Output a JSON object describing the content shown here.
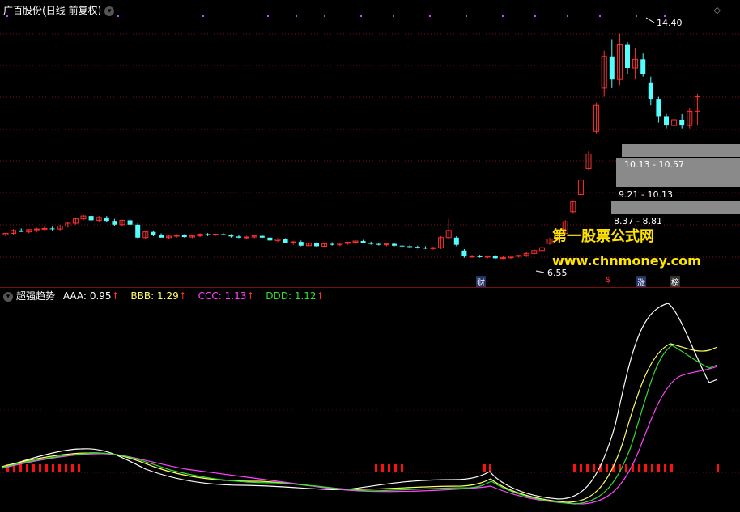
{
  "price_header": {
    "stock_name": "广百股份",
    "period": "(日线 前复权)",
    "dropdown_glyph": "▾"
  },
  "indicator_header": {
    "name": "超强趋势",
    "items": [
      {
        "label": "AAA:",
        "value": "0.95",
        "arrow": "↑",
        "color": "#ffffff"
      },
      {
        "label": "BBB:",
        "value": "1.29",
        "arrow": "↑",
        "color": "#ffff66"
      },
      {
        "label": "CCC:",
        "value": "1.13",
        "arrow": "↑",
        "color": "#ff44ff"
      },
      {
        "label": "DDD:",
        "value": "1.12",
        "arrow": "↑",
        "color": "#33dd33"
      }
    ]
  },
  "annotations": {
    "high": "14.40",
    "low": "6.55",
    "zone1": "10.13 - 10.57",
    "zone2": "9.21 - 10.13",
    "zone3": "8.37 - 8.81"
  },
  "event_tags": [
    {
      "text": "财",
      "color": "#3a6cff"
    },
    {
      "text": "$",
      "color": "#ff3333"
    },
    {
      "text": "涨",
      "color": "#3a9cff"
    },
    {
      "text": "榜",
      "color": "#ffcc00"
    }
  ],
  "watermark": {
    "line1": "第一股票公式网",
    "line2": "www.chnmoney.com"
  },
  "colors": {
    "up": "#ff3030",
    "down": "#54ffff",
    "grid": "#7a1010"
  },
  "chart_data": {
    "type": "candlestick",
    "ylim": [
      6,
      15
    ],
    "candles": [
      [
        7.4,
        7.45,
        7.35,
        7.45
      ],
      [
        7.45,
        7.6,
        7.4,
        7.55
      ],
      [
        7.55,
        7.62,
        7.5,
        7.5
      ],
      [
        7.5,
        7.6,
        7.45,
        7.58
      ],
      [
        7.58,
        7.64,
        7.5,
        7.6
      ],
      [
        7.6,
        7.7,
        7.55,
        7.62
      ],
      [
        7.62,
        7.68,
        7.55,
        7.6
      ],
      [
        7.6,
        7.75,
        7.55,
        7.7
      ],
      [
        7.7,
        7.85,
        7.65,
        7.8
      ],
      [
        7.8,
        8.0,
        7.75,
        7.95
      ],
      [
        7.95,
        8.1,
        7.9,
        8.05
      ],
      [
        8.05,
        8.1,
        7.85,
        7.9
      ],
      [
        7.9,
        8.05,
        7.85,
        8.0
      ],
      [
        8.0,
        8.05,
        7.85,
        7.88
      ],
      [
        7.88,
        7.95,
        7.7,
        7.75
      ],
      [
        7.75,
        7.92,
        7.7,
        7.9
      ],
      [
        7.9,
        7.95,
        7.7,
        7.75
      ],
      [
        7.75,
        7.8,
        7.25,
        7.3
      ],
      [
        7.3,
        7.55,
        7.25,
        7.5
      ],
      [
        7.5,
        7.55,
        7.35,
        7.4
      ],
      [
        7.4,
        7.45,
        7.3,
        7.3
      ],
      [
        7.3,
        7.4,
        7.25,
        7.35
      ],
      [
        7.35,
        7.42,
        7.3,
        7.38
      ],
      [
        7.38,
        7.42,
        7.3,
        7.32
      ],
      [
        7.32,
        7.4,
        7.28,
        7.36
      ],
      [
        7.36,
        7.45,
        7.32,
        7.42
      ],
      [
        7.42,
        7.46,
        7.35,
        7.4
      ],
      [
        7.4,
        7.44,
        7.36,
        7.42
      ],
      [
        7.42,
        7.46,
        7.38,
        7.4
      ],
      [
        7.4,
        7.42,
        7.3,
        7.34
      ],
      [
        7.34,
        7.38,
        7.28,
        7.3
      ],
      [
        7.3,
        7.36,
        7.25,
        7.32
      ],
      [
        7.32,
        7.4,
        7.28,
        7.36
      ],
      [
        7.36,
        7.38,
        7.28,
        7.3
      ],
      [
        7.3,
        7.32,
        7.18,
        7.2
      ],
      [
        7.2,
        7.28,
        7.15,
        7.25
      ],
      [
        7.25,
        7.28,
        7.1,
        7.12
      ],
      [
        7.12,
        7.18,
        7.05,
        7.15
      ],
      [
        7.15,
        7.2,
        7.0,
        7.02
      ],
      [
        7.02,
        7.12,
        7.0,
        7.1
      ],
      [
        7.1,
        7.14,
        6.98,
        7.0
      ],
      [
        7.0,
        7.1,
        6.98,
        7.08
      ],
      [
        7.08,
        7.14,
        7.02,
        7.05
      ],
      [
        7.05,
        7.12,
        7.0,
        7.1
      ],
      [
        7.1,
        7.16,
        7.05,
        7.14
      ],
      [
        7.14,
        7.2,
        7.08,
        7.18
      ],
      [
        7.18,
        7.22,
        7.1,
        7.12
      ],
      [
        7.12,
        7.16,
        7.05,
        7.08
      ],
      [
        7.08,
        7.12,
        7.02,
        7.05
      ],
      [
        7.05,
        7.1,
        7.0,
        7.08
      ],
      [
        7.08,
        7.1,
        7.0,
        7.02
      ],
      [
        7.02,
        7.06,
        6.96,
        7.0
      ],
      [
        7.0,
        7.04,
        6.94,
        6.98
      ],
      [
        6.98,
        7.02,
        6.92,
        6.95
      ],
      [
        6.95,
        7.0,
        6.9,
        6.92
      ],
      [
        6.92,
        6.98,
        6.88,
        6.95
      ],
      [
        6.95,
        7.35,
        6.9,
        7.3
      ],
      [
        7.3,
        7.95,
        7.25,
        7.55
      ],
      [
        7.3,
        7.35,
        7.0,
        7.05
      ],
      [
        6.85,
        6.9,
        6.6,
        6.65
      ],
      [
        6.65,
        6.7,
        6.6,
        6.65
      ],
      [
        6.65,
        6.7,
        6.6,
        6.62
      ],
      [
        6.62,
        6.68,
        6.58,
        6.65
      ],
      [
        6.65,
        6.7,
        6.55,
        6.58
      ],
      [
        6.58,
        6.65,
        6.55,
        6.6
      ],
      [
        6.6,
        6.68,
        6.56,
        6.65
      ],
      [
        6.65,
        6.7,
        6.6,
        6.68
      ],
      [
        6.68,
        6.8,
        6.62,
        6.75
      ],
      [
        6.75,
        6.9,
        6.7,
        6.85
      ],
      [
        6.85,
        7.0,
        6.8,
        6.95
      ],
      [
        7.1,
        7.3,
        7.05,
        7.25
      ],
      [
        7.25,
        7.5,
        7.2,
        7.45
      ],
      [
        7.45,
        7.9,
        7.4,
        7.85
      ],
      [
        8.2,
        8.6,
        8.15,
        8.55
      ],
      [
        8.8,
        9.4,
        8.75,
        9.3
      ],
      [
        9.7,
        10.3,
        9.65,
        10.2
      ],
      [
        11.0,
        12.0,
        10.9,
        11.9
      ],
      [
        12.5,
        13.8,
        12.2,
        13.6
      ],
      [
        13.6,
        14.2,
        12.5,
        12.8
      ],
      [
        12.8,
        14.4,
        12.6,
        14.0
      ],
      [
        14.0,
        14.1,
        13.0,
        13.2
      ],
      [
        13.2,
        13.9,
        12.8,
        13.5
      ],
      [
        13.5,
        13.7,
        12.9,
        13.0
      ],
      [
        12.7,
        12.9,
        11.9,
        12.1
      ],
      [
        12.1,
        12.2,
        11.3,
        11.5
      ],
      [
        11.5,
        11.6,
        11.1,
        11.2
      ],
      [
        11.2,
        11.5,
        11.0,
        11.4
      ],
      [
        11.4,
        11.6,
        11.1,
        11.2
      ],
      [
        11.2,
        11.8,
        11.1,
        11.7
      ],
      [
        11.7,
        12.3,
        11.2,
        12.2
      ]
    ]
  }
}
